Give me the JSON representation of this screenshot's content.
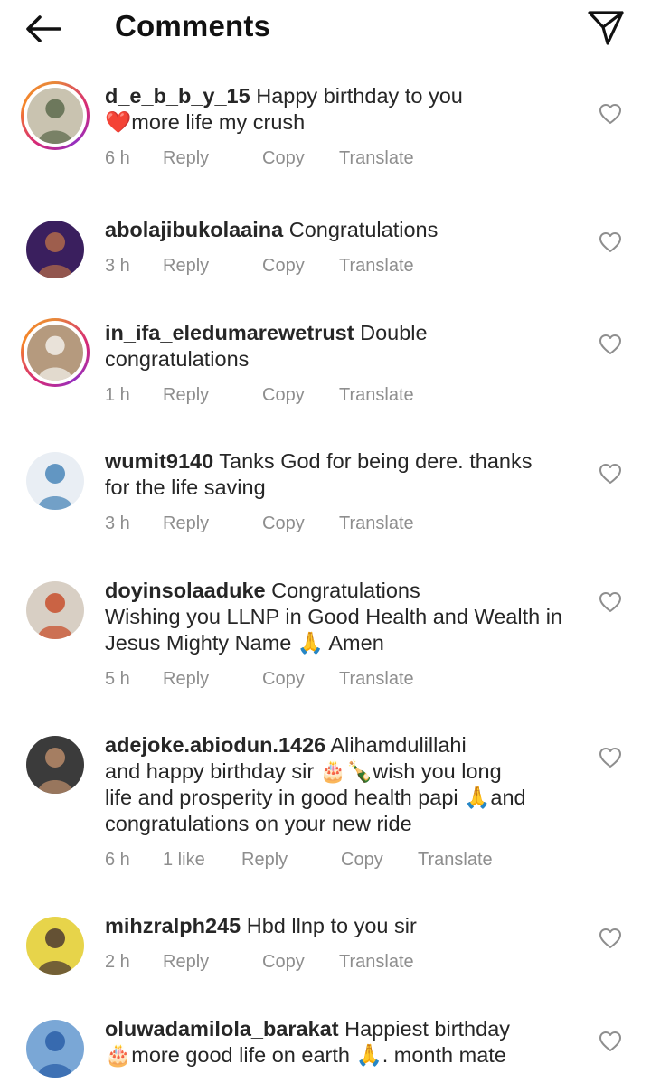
{
  "header": {
    "title": "Comments"
  },
  "actions": {
    "reply": "Reply",
    "copy": "Copy",
    "translate": "Translate"
  },
  "comments": [
    {
      "user": "d_e_b_b_y_15",
      "text": "Happy birthday to you\n❤️more life my crush",
      "time": "6 h",
      "likes": "",
      "story_ring": true,
      "avatar_colors": [
        "#c9c3b0",
        "#5d6b4e"
      ]
    },
    {
      "user": "abolajibukolaaina",
      "text": "Congratulations",
      "time": "3 h",
      "likes": "",
      "story_ring": false,
      "avatar_colors": [
        "#3a1f5e",
        "#b06a4a"
      ]
    },
    {
      "user": "in_ifa_eledumarewetrust",
      "text": "Double\ncongratulations",
      "time": "1 h",
      "likes": "",
      "story_ring": true,
      "avatar_colors": [
        "#b59a7e",
        "#f2efe9"
      ]
    },
    {
      "user": "wumit9140",
      "text": "Tanks God for being dere. thanks\nfor the life saving",
      "time": "3 h",
      "likes": "",
      "story_ring": false,
      "avatar_colors": [
        "#e9eef4",
        "#4a86b8"
      ]
    },
    {
      "user": "doyinsolaaduke",
      "text": "Congratulations\nWishing you LLNP in Good Health and Wealth in\nJesus Mighty Name 🙏 Amen",
      "time": "5 h",
      "likes": "",
      "story_ring": false,
      "avatar_colors": [
        "#d8cfc4",
        "#c8502e"
      ]
    },
    {
      "user": "adejoke.abiodun.1426",
      "text": "Alihamdulillahi\nand happy birthday sir 🎂🍾wish you long\nlife and prosperity in good health papi 🙏and\ncongratulations on your new ride",
      "time": "6 h",
      "likes": "1 like",
      "story_ring": false,
      "avatar_colors": [
        "#3b3b3b",
        "#b88b6a"
      ]
    },
    {
      "user": "mihzralph245",
      "text": "Hbd llnp to you sir",
      "time": "2 h",
      "likes": "",
      "story_ring": false,
      "avatar_colors": [
        "#e7d44a",
        "#4c3a30"
      ]
    },
    {
      "user": "oluwadamilola_barakat",
      "text": "Happiest birthday\n🎂more good life on earth 🙏. month mate",
      "time": "",
      "likes": "",
      "story_ring": false,
      "avatar_colors": [
        "#7aa7d6",
        "#2b5fa8"
      ]
    }
  ]
}
